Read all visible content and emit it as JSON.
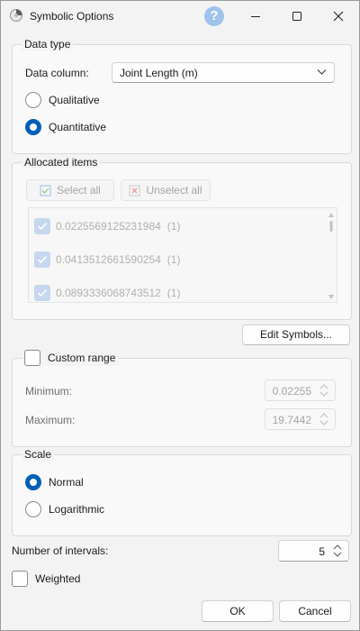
{
  "window": {
    "title": "Symbolic Options",
    "help_label": "?"
  },
  "data_type": {
    "title": "Data type",
    "column_label": "Data column:",
    "column_value": "Joint Length (m)",
    "options": [
      {
        "label": "Qualitative",
        "checked": false
      },
      {
        "label": "Quantitative",
        "checked": true
      }
    ]
  },
  "allocated": {
    "title": "Allocated items",
    "select_all": "Select all",
    "unselect_all": "Unselect all",
    "items": [
      {
        "value": "0.0225569125231984",
        "count": "(1)",
        "checked": true
      },
      {
        "value": "0.0413512661590254",
        "count": "(1)",
        "checked": true
      },
      {
        "value": "0.0893336068743512",
        "count": "(1)",
        "checked": true
      }
    ]
  },
  "edit_symbols_label": "Edit Symbols...",
  "custom_range": {
    "label": "Custom range",
    "checked": false,
    "minimum_label": "Minimum:",
    "minimum_value": "0.02255",
    "maximum_label": "Maximum:",
    "maximum_value": "19.7442"
  },
  "scale": {
    "title": "Scale",
    "options": [
      {
        "label": "Normal",
        "checked": true
      },
      {
        "label": "Logarithmic",
        "checked": false
      }
    ]
  },
  "intervals": {
    "label": "Number of intervals:",
    "value": "5"
  },
  "weighted": {
    "label": "Weighted",
    "checked": false
  },
  "footer": {
    "ok": "OK",
    "cancel": "Cancel"
  },
  "colors": {
    "accent": "#005fb8",
    "help": "#9fc3e9",
    "disabled_text": "#a5a5a5"
  }
}
